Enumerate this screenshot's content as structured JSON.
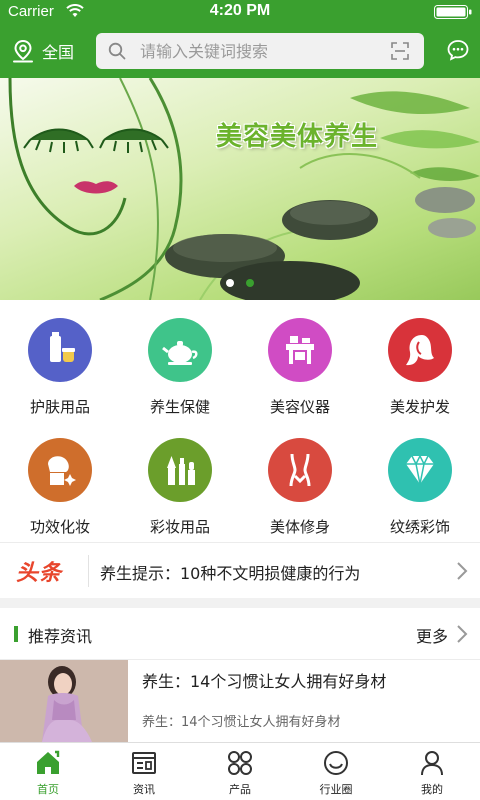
{
  "status_bar": {
    "carrier": "Carrier",
    "time": "4:20 PM"
  },
  "header": {
    "location_label": "全国",
    "search_placeholder": "请输入关键词搜索",
    "icons": [
      "location-pin-icon",
      "search-icon",
      "scan-icon",
      "message-icon"
    ]
  },
  "banner": {
    "title": "美容美体养生",
    "dots": {
      "count": 2,
      "active_index": 1
    }
  },
  "categories": [
    {
      "label": "护肤用品",
      "icon": "skincare-icon",
      "color": "#5561c8"
    },
    {
      "label": "养生保健",
      "icon": "teapot-icon",
      "color": "#3fc48a"
    },
    {
      "label": "美容仪器",
      "icon": "beauty-device-icon",
      "color": "#d04cc4"
    },
    {
      "label": "美发护发",
      "icon": "hair-icon",
      "color": "#d8333a"
    },
    {
      "label": "功效化妆",
      "icon": "makeup-face-icon",
      "color": "#cf6e2c"
    },
    {
      "label": "彩妆用品",
      "icon": "cosmetics-icon",
      "color": "#6b9e2b"
    },
    {
      "label": "美体修身",
      "icon": "body-shape-icon",
      "color": "#d84a3f"
    },
    {
      "label": "纹绣彩饰",
      "icon": "diamond-icon",
      "color": "#2fc1b0"
    }
  ],
  "headline": {
    "logo": "头条",
    "text": "养生提示：10种不文明损健康的行为"
  },
  "recommend": {
    "title": "推荐资讯",
    "more": "更多",
    "items": [
      {
        "title": "养生：14个习惯让女人拥有好身材",
        "summary": "养生：14个习惯让女人拥有好身材"
      }
    ]
  },
  "tabbar": {
    "items": [
      {
        "label": "首页",
        "icon": "home-icon",
        "active": true
      },
      {
        "label": "资讯",
        "icon": "news-icon",
        "active": false
      },
      {
        "label": "产品",
        "icon": "products-grid-icon",
        "active": false
      },
      {
        "label": "行业圈",
        "icon": "circle-smile-icon",
        "active": false
      },
      {
        "label": "我的",
        "icon": "user-icon",
        "active": false
      }
    ]
  },
  "colors": {
    "brand": "#3aa02f",
    "headline_logo": "#e8452c"
  }
}
